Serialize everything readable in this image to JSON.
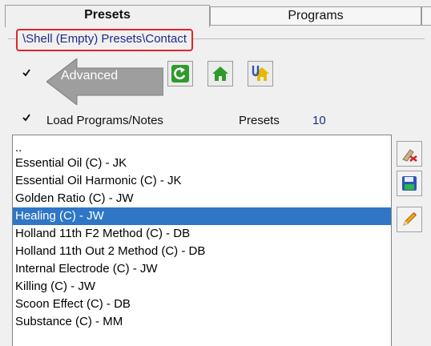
{
  "tabs": [
    {
      "label": "Presets",
      "active": true
    },
    {
      "label": "Programs",
      "active": false
    }
  ],
  "path": "\\Shell (Empty) Presets\\Contact",
  "advanced": {
    "label": "Advanced",
    "checked": true
  },
  "toolbar": {
    "icons": [
      "refresh-icon",
      "home-icon",
      "home-up-icon"
    ],
    "colors": {
      "green": "#2f9a2b",
      "yellow": "#e8b800",
      "blue": "#2f54b8"
    }
  },
  "load": {
    "label": "Load Programs/Notes",
    "checked": true
  },
  "presets": {
    "label": "Presets",
    "count": "10"
  },
  "list": {
    "items": [
      "..",
      "Essential Oil (C) - JK",
      "Essential Oil Harmonic (C) - JK",
      "Golden Ratio (C) - JW",
      "Healing (C) - JW",
      "Holland 11th F2 Method (C) - DB",
      "Holland 11th Out 2 Method (C) - DB",
      "Internal Electrode (C) - JW",
      "Killing (C) - JW",
      "Scoon Effect (C) - DB",
      "Substance (C) - MM"
    ],
    "selected_index": 4,
    "selection_color": "#2f76c6"
  },
  "side_buttons": [
    "clear-icon",
    "save-icon",
    "edit-icon"
  ],
  "accent": {
    "path_border": "#e0262a",
    "path_text": "#1c2a86"
  }
}
